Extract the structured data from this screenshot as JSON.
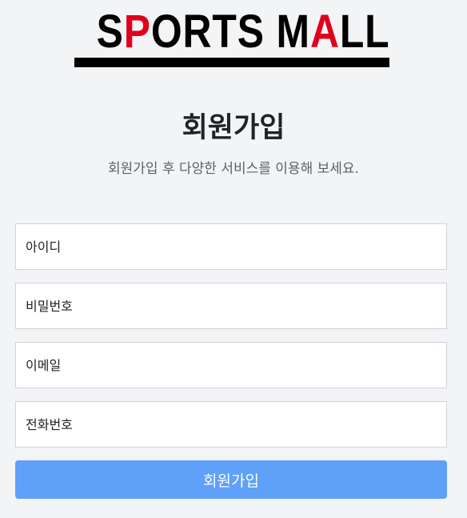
{
  "logo": {
    "part1": "S",
    "part2": "P",
    "part3": "ORTS M",
    "part4": "A",
    "part5": "LL"
  },
  "header": {
    "title": "회원가입",
    "subtitle": "회원가입 후 다양한 서비스를 이용해 보세요."
  },
  "form": {
    "username_placeholder": "아이디",
    "password_placeholder": "비밀번호",
    "email_placeholder": "이메일",
    "phone_placeholder": "전화번호",
    "submit_label": "회원가입"
  },
  "colors": {
    "logo_accent": "#e0001b",
    "button_bg": "#5fa0f9",
    "page_bg": "#f3f4f6"
  }
}
